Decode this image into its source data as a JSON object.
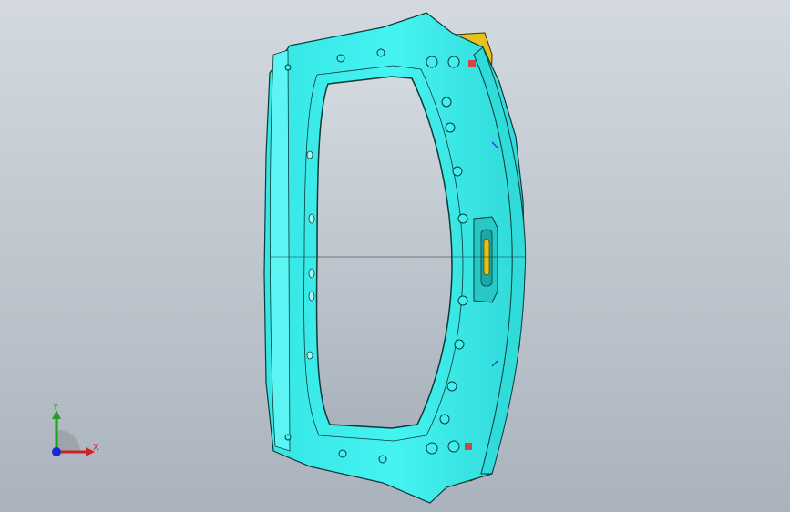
{
  "app": {
    "type": "cad-3d-viewport"
  },
  "viewport": {
    "background_top": "#d2d8de",
    "background_bottom": "#aeb6bf",
    "model": {
      "name": "",
      "body_color": "#3ff0ee",
      "body_dark_color": "#22c9c7",
      "edge_color": "#0a3a3a",
      "bracket_color": "#e8c21a",
      "accent_color": "#d04545"
    }
  },
  "triad": {
    "x_label": "X",
    "y_label": "Y",
    "x_color": "#d02020",
    "y_color": "#20a020",
    "z_color": "#1a2ad0"
  }
}
